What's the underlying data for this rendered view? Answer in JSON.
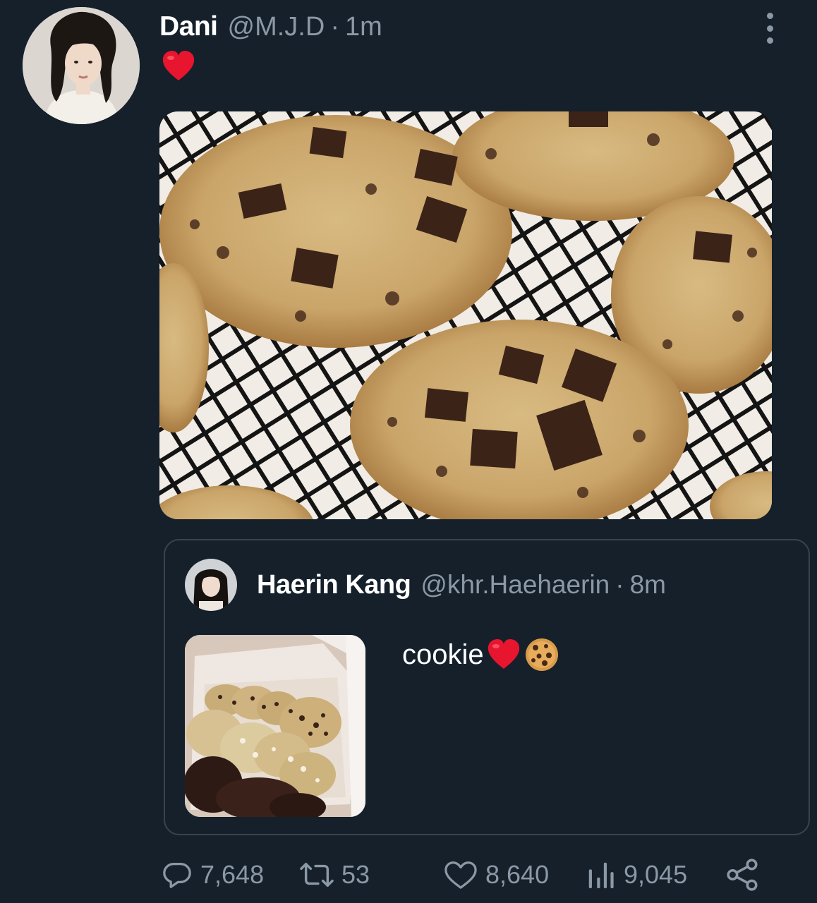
{
  "tweet": {
    "author": {
      "display_name": "Dani",
      "handle": "@M.J.D",
      "separator": "·",
      "time": "1m"
    },
    "emoji": "heart-emoji"
  },
  "quote": {
    "author": {
      "display_name": "Haerin Kang",
      "handle": "@khr.Haehaerin",
      "separator": "·",
      "time": "8m"
    },
    "text": "cookie",
    "emojis": [
      "heart-emoji",
      "cookie-emoji"
    ]
  },
  "actions": {
    "replies": "7,648",
    "retweets": "53",
    "likes": "8,640",
    "views": "9,045"
  },
  "colors": {
    "background": "#15202b",
    "secondary_text": "#8b98a5",
    "border": "#38444d",
    "heart": "#e0245e"
  }
}
